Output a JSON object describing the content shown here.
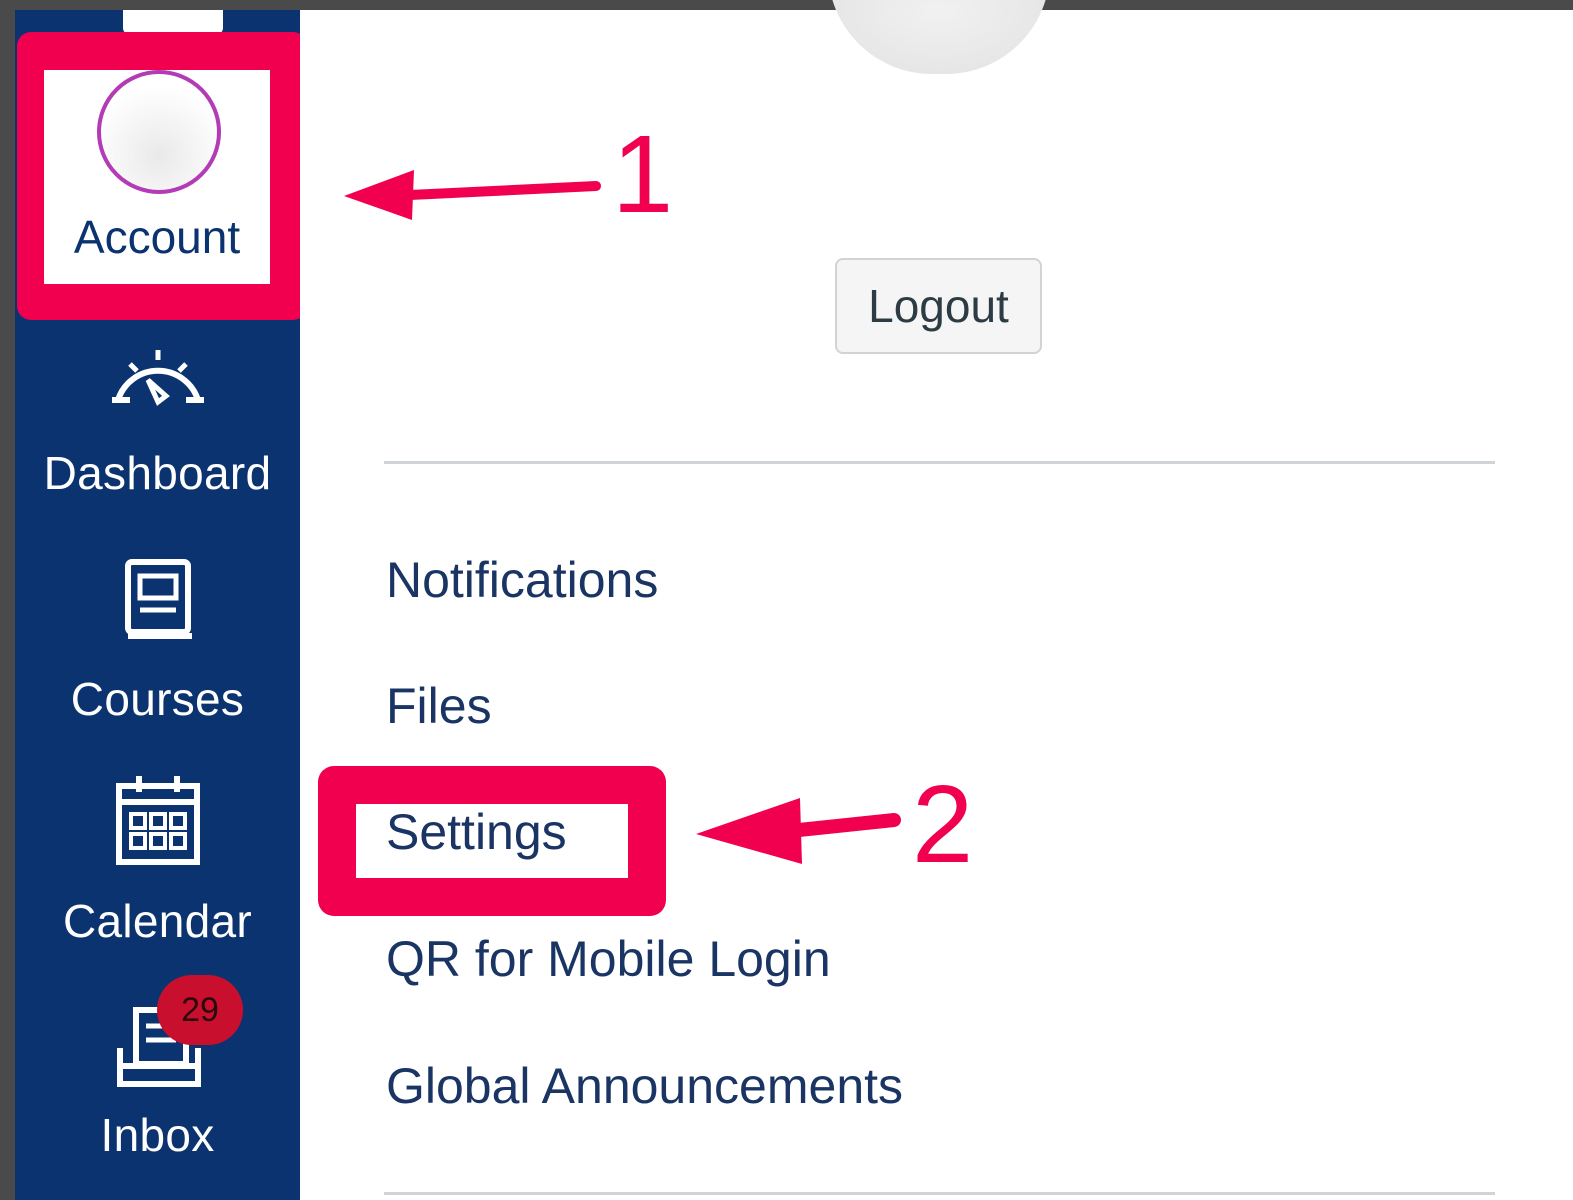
{
  "global_nav": {
    "account_label": "Account",
    "items": [
      {
        "label": "Dashboard",
        "icon": "dashboard-icon"
      },
      {
        "label": "Courses",
        "icon": "courses-icon"
      },
      {
        "label": "Calendar",
        "icon": "calendar-icon"
      },
      {
        "label": "Inbox",
        "icon": "inbox-icon",
        "badge": "29"
      }
    ]
  },
  "account_tray": {
    "logout_label": "Logout",
    "links": [
      "Notifications",
      "Files",
      "Settings",
      "QR for Mobile Login",
      "Global Announcements"
    ]
  },
  "annotations": {
    "step1": "1",
    "step2": "2",
    "highlight_color": "#f0004f"
  },
  "colors": {
    "nav_background": "#0b3370",
    "link_text": "#1a3464",
    "badge": "#c8102e"
  }
}
